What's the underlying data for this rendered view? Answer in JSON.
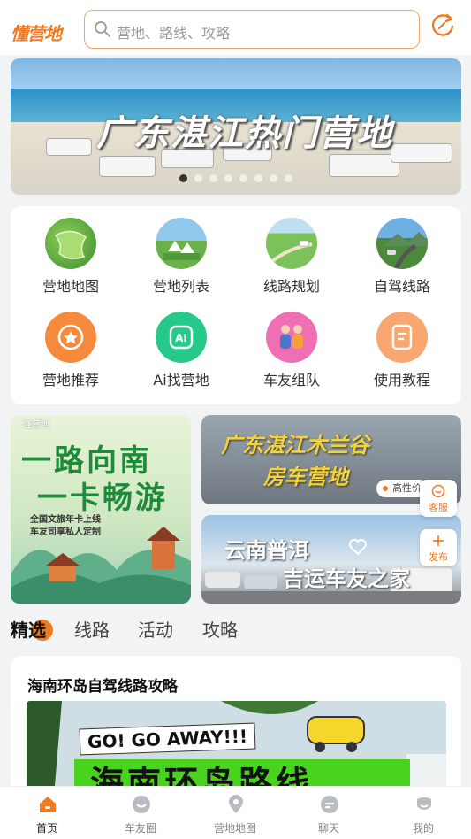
{
  "app": {
    "logo": "懂营地",
    "brand_color": "#f07a22"
  },
  "search": {
    "placeholder": "营地、路线、攻略"
  },
  "banner": {
    "title": "广东湛江热门营地",
    "slide_count": 8,
    "active_slide": 1
  },
  "grid": {
    "items": [
      {
        "label": "营地地图",
        "icon": "map-photo-icon"
      },
      {
        "label": "营地列表",
        "icon": "camp-list-photo-icon"
      },
      {
        "label": "线路规划",
        "icon": "route-photo-icon"
      },
      {
        "label": "自驾线路",
        "icon": "road-trip-photo-icon"
      },
      {
        "label": "营地推荐",
        "icon": "medal-icon"
      },
      {
        "label": "Ai找营地",
        "icon": "ai-icon"
      },
      {
        "label": "车友组队",
        "icon": "team-icon"
      },
      {
        "label": "使用教程",
        "icon": "tutorial-icon"
      }
    ]
  },
  "promos": {
    "left": {
      "watermark": "懂营地",
      "line1": "一路向南",
      "line2": "一卡畅游",
      "sub1": "全国文旅年卡上线",
      "sub2": "车友司享私人定制"
    },
    "right_top": {
      "line1": "广东湛江木兰谷",
      "line2": "房车营地",
      "badge": "高性价"
    },
    "right_bottom": {
      "line1": "云南普洱",
      "line2": "吉运车友之家"
    }
  },
  "floats": {
    "service": "客服",
    "publish": "发布"
  },
  "tabs": [
    "精选",
    "线路",
    "活动",
    "攻略"
  ],
  "article": {
    "title": "海南环岛自驾线路攻略",
    "banner_text": "GO! GO AWAY!!!",
    "big_text": "海南环岛路线"
  },
  "nav": [
    {
      "label": "首页",
      "icon": "home-icon"
    },
    {
      "label": "车友圈",
      "icon": "circle-icon"
    },
    {
      "label": "营地地图",
      "icon": "location-pin-icon"
    },
    {
      "label": "聊天",
      "icon": "chat-icon"
    },
    {
      "label": "我的",
      "icon": "profile-icon"
    }
  ]
}
